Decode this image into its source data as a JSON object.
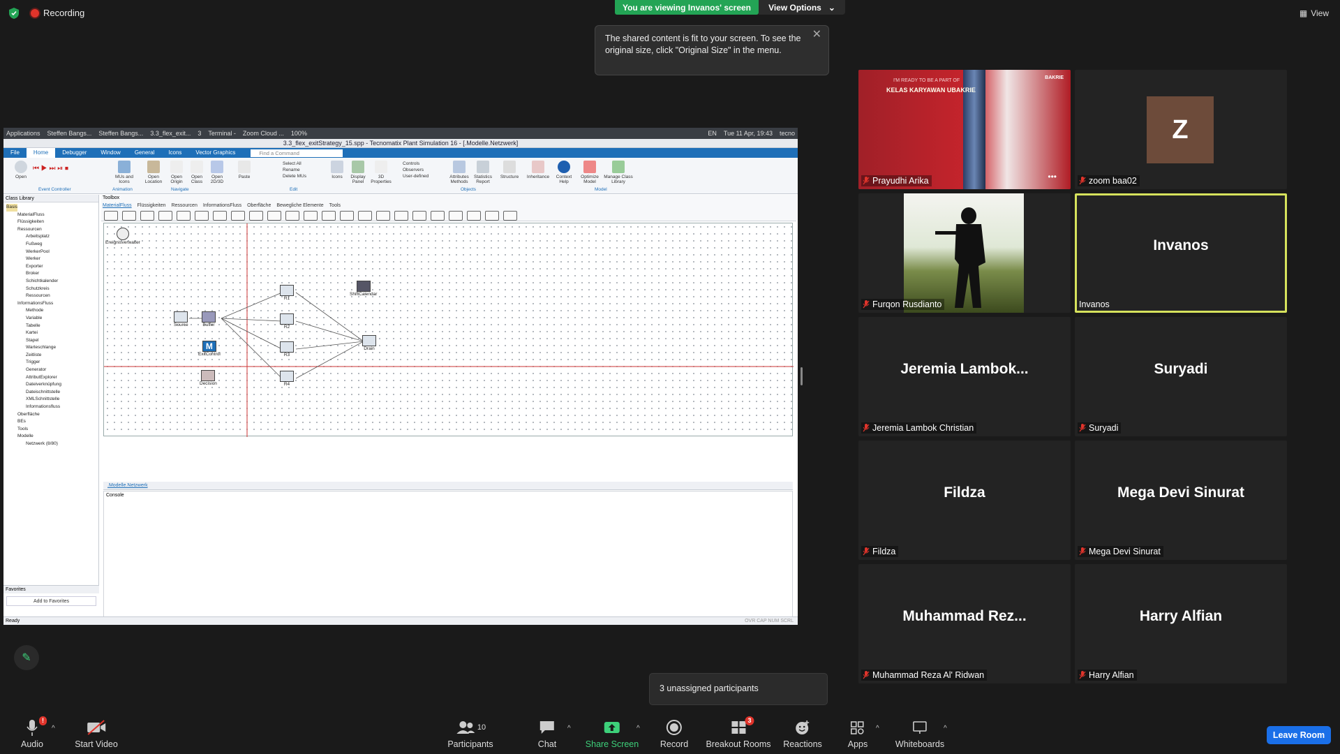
{
  "top": {
    "recording_label": "Recording",
    "viewing_banner": "You are viewing Invanos' screen",
    "view_options_label": "View Options",
    "tooltip_text": "The shared content is fit to your screen. To see the original size, click \"Original Size\" in the menu.",
    "view_label": "View"
  },
  "shared_screen": {
    "taskbar": [
      "Applications",
      "Steffen Bangs...",
      "Steffen Bangs...",
      "3.3_flex_exit...",
      "3",
      "Terminal -",
      "Zoom Cloud ...",
      "100%",
      "EN",
      "Tue 11 Apr, 19:43",
      "tecno"
    ],
    "window_title": "3.3_flex_exitStrategy_15.spp - Tecnomatix Plant Simulation 16 - [.Modelle.Netzwerk]",
    "ribbon_tabs": [
      "File",
      "Home",
      "Debugger",
      "Window",
      "General",
      "Icons",
      "Vector Graphics"
    ],
    "find_command": "Find a Command",
    "ribbon_buttons": [
      "Open",
      "MUs and Icons",
      "Open Location",
      "Open Origin",
      "Open Class",
      "Open 2D/3D",
      "Paste",
      "Cut",
      "Copy",
      "Delete",
      "Select All",
      "Rename",
      "Delete MUs",
      "Icons",
      "Display Panel",
      "3D Properties",
      "Controls",
      "Observers",
      "User-defined",
      "Attributes Methods",
      "Statistics Report",
      "Structure",
      "Inheritance",
      "Context Help",
      "Optimize Model",
      "Manage Class Library"
    ],
    "ribbon_groups": [
      "Event Controller",
      "Animation",
      "Navigate",
      "Edit",
      "Objects",
      "Model"
    ],
    "class_library_title": "Class Library",
    "tree": [
      "Basis",
      "MaterialFluss",
      "Flüssigkeiten",
      "Ressourcen",
      "Arbeitsplatz",
      "Fußweg",
      "WerkerPool",
      "Werker",
      "Exporter",
      "Broker",
      "Schichtkalender",
      "Schutzkreis",
      "Ressourcen",
      "InformationsFluss",
      "Methode",
      "Variable",
      "Tabelle",
      "Kartei",
      "Stapel",
      "Warteschlange",
      "Zeitliste",
      "Trigger",
      "Generator",
      "AttributExplorer",
      "Dateiverknüpfung",
      "Dateischnittstelle",
      "XMLSchnittstelle",
      "Informationsfluss",
      "Oberfläche",
      "BEs",
      "Tools",
      "Modelle",
      "Netzwerk (8/80)"
    ],
    "favorites_title": "Favorites",
    "add_to_favorites": "Add to Favorites",
    "toolbox_title": "Toolbox",
    "toolbox_tabs": [
      "MaterialFluss",
      "Flüssigkeiten",
      "Ressourcen",
      "InformationsFluss",
      "Oberfläche",
      "Bewegliche Elemente",
      "Tools"
    ],
    "nodes": {
      "event": "Ereignisverwalter",
      "source": "Source",
      "buffer": "Buffer",
      "exitcontrol": "ExitControl",
      "decision": "Decision",
      "r1": "R1",
      "r2": "R2",
      "r3": "R3",
      "r4": "R4",
      "shiftcalendar": "ShiftCalendar",
      "drain": "Drain"
    },
    "canvas_tab": ".Modelle.Netzwerk",
    "console_title": "Console",
    "status_text": "Ready",
    "status_right": "OVR  CAP  NUM  SCRL"
  },
  "participants": [
    {
      "name": "Prayudhi Arika",
      "display": ""
    },
    {
      "name": "zoom baa02",
      "display": "Z"
    },
    {
      "name": "Furqon Rusdianto",
      "display": ""
    },
    {
      "name": "Invanos",
      "display": "Invanos"
    },
    {
      "name": "Jeremia Lambok Christian",
      "display": "Jeremia  Lambok..."
    },
    {
      "name": "Suryadi",
      "display": "Suryadi"
    },
    {
      "name": "Fildza",
      "display": "Fildza"
    },
    {
      "name": "Mega Devi Sinurat",
      "display": "Mega Devi Sinurat"
    },
    {
      "name": "Muhammad Reza Al' Ridwan",
      "display": "Muhammad  Rez..."
    },
    {
      "name": "Harry Alfian",
      "display": "Harry Alfian"
    }
  ],
  "banner_image": {
    "line1": "I'M READY TO BE A PART OF",
    "line2": "KELAS KARYAWAN UBAKRIE",
    "brand": "BAKRIE"
  },
  "unassigned_text": "3 unassigned participants",
  "toolbar": {
    "audio": "Audio",
    "audio_badge": "!",
    "start_video": "Start Video",
    "participants": "Participants",
    "participants_count": "10",
    "chat": "Chat",
    "share_screen": "Share Screen",
    "record": "Record",
    "breakout_rooms": "Breakout Rooms",
    "breakout_badge": "3",
    "reactions": "Reactions",
    "apps": "Apps",
    "whiteboards": "Whiteboards",
    "leave_room": "Leave Room"
  },
  "colors": {
    "viewing_green": "#23a455",
    "speaking_border": "#d6e25c",
    "leave_blue": "#1a6fe8",
    "share_green": "#3dd07a",
    "mic_red": "#e0342b"
  }
}
